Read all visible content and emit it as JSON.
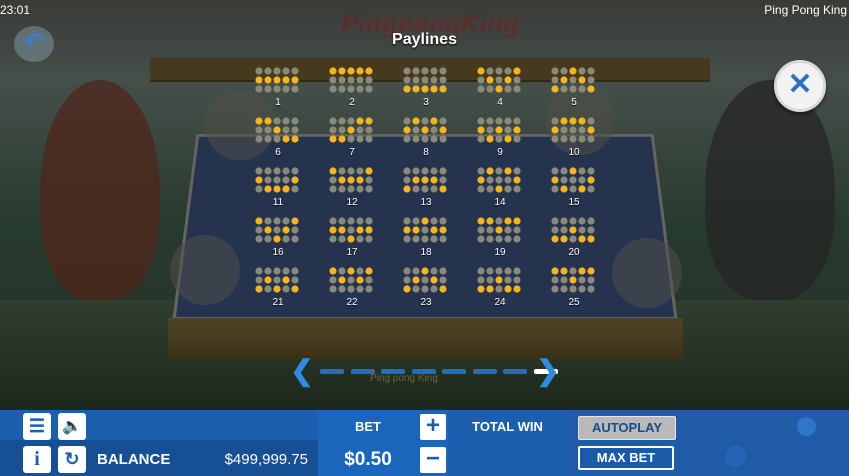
{
  "status_bar": {
    "time": "23:01",
    "app_title": "Ping Pong King"
  },
  "game": {
    "logo": "PingpongKing"
  },
  "paylines_panel": {
    "title": "Paylines",
    "lines": [
      {
        "num": "1",
        "pattern": [
          [
            0,
            0,
            0,
            0,
            0
          ],
          [
            1,
            1,
            1,
            1,
            1
          ],
          [
            0,
            0,
            0,
            0,
            0
          ]
        ]
      },
      {
        "num": "2",
        "pattern": [
          [
            1,
            1,
            1,
            1,
            1
          ],
          [
            0,
            0,
            0,
            0,
            0
          ],
          [
            0,
            0,
            0,
            0,
            0
          ]
        ]
      },
      {
        "num": "3",
        "pattern": [
          [
            0,
            0,
            0,
            0,
            0
          ],
          [
            0,
            0,
            0,
            0,
            0
          ],
          [
            1,
            1,
            1,
            1,
            1
          ]
        ]
      },
      {
        "num": "4",
        "pattern": [
          [
            1,
            0,
            0,
            0,
            1
          ],
          [
            0,
            1,
            0,
            1,
            0
          ],
          [
            0,
            0,
            1,
            0,
            0
          ]
        ]
      },
      {
        "num": "5",
        "pattern": [
          [
            0,
            0,
            1,
            0,
            0
          ],
          [
            0,
            1,
            0,
            1,
            0
          ],
          [
            1,
            0,
            0,
            0,
            1
          ]
        ]
      },
      {
        "num": "6",
        "pattern": [
          [
            1,
            1,
            0,
            0,
            0
          ],
          [
            0,
            0,
            1,
            0,
            0
          ],
          [
            0,
            0,
            0,
            1,
            1
          ]
        ]
      },
      {
        "num": "7",
        "pattern": [
          [
            0,
            0,
            0,
            1,
            1
          ],
          [
            0,
            0,
            1,
            0,
            0
          ],
          [
            1,
            1,
            0,
            0,
            0
          ]
        ]
      },
      {
        "num": "8",
        "pattern": [
          [
            0,
            1,
            0,
            1,
            0
          ],
          [
            1,
            0,
            1,
            0,
            1
          ],
          [
            0,
            0,
            0,
            0,
            0
          ]
        ]
      },
      {
        "num": "9",
        "pattern": [
          [
            0,
            0,
            0,
            0,
            0
          ],
          [
            1,
            0,
            1,
            0,
            1
          ],
          [
            0,
            1,
            0,
            1,
            0
          ]
        ]
      },
      {
        "num": "10",
        "pattern": [
          [
            0,
            1,
            1,
            1,
            0
          ],
          [
            1,
            0,
            0,
            0,
            1
          ],
          [
            0,
            0,
            0,
            0,
            0
          ]
        ]
      },
      {
        "num": "11",
        "pattern": [
          [
            0,
            0,
            0,
            0,
            0
          ],
          [
            1,
            0,
            0,
            0,
            1
          ],
          [
            0,
            1,
            1,
            1,
            0
          ]
        ]
      },
      {
        "num": "12",
        "pattern": [
          [
            1,
            0,
            0,
            0,
            1
          ],
          [
            0,
            1,
            1,
            1,
            0
          ],
          [
            0,
            0,
            0,
            0,
            0
          ]
        ]
      },
      {
        "num": "13",
        "pattern": [
          [
            0,
            0,
            0,
            0,
            0
          ],
          [
            0,
            1,
            1,
            1,
            0
          ],
          [
            1,
            0,
            0,
            0,
            1
          ]
        ]
      },
      {
        "num": "14",
        "pattern": [
          [
            0,
            1,
            0,
            1,
            0
          ],
          [
            1,
            0,
            0,
            0,
            1
          ],
          [
            0,
            0,
            1,
            0,
            0
          ]
        ]
      },
      {
        "num": "15",
        "pattern": [
          [
            0,
            0,
            1,
            0,
            0
          ],
          [
            1,
            0,
            0,
            0,
            1
          ],
          [
            0,
            1,
            0,
            1,
            0
          ]
        ]
      },
      {
        "num": "16",
        "pattern": [
          [
            1,
            0,
            0,
            0,
            1
          ],
          [
            0,
            1,
            0,
            1,
            0
          ],
          [
            0,
            0,
            1,
            0,
            0
          ]
        ]
      },
      {
        "num": "17",
        "pattern": [
          [
            0,
            0,
            0,
            0,
            0
          ],
          [
            1,
            1,
            0,
            1,
            1
          ],
          [
            0,
            0,
            1,
            0,
            0
          ]
        ]
      },
      {
        "num": "18",
        "pattern": [
          [
            0,
            0,
            1,
            0,
            0
          ],
          [
            1,
            1,
            0,
            1,
            1
          ],
          [
            0,
            0,
            0,
            0,
            0
          ]
        ]
      },
      {
        "num": "19",
        "pattern": [
          [
            1,
            1,
            0,
            1,
            1
          ],
          [
            0,
            0,
            1,
            0,
            0
          ],
          [
            0,
            0,
            0,
            0,
            0
          ]
        ]
      },
      {
        "num": "20",
        "pattern": [
          [
            0,
            0,
            0,
            0,
            0
          ],
          [
            0,
            0,
            1,
            0,
            0
          ],
          [
            1,
            1,
            0,
            1,
            1
          ]
        ]
      },
      {
        "num": "21",
        "pattern": [
          [
            0,
            0,
            0,
            0,
            0
          ],
          [
            0,
            1,
            0,
            1,
            0
          ],
          [
            1,
            0,
            1,
            0,
            1
          ]
        ]
      },
      {
        "num": "22",
        "pattern": [
          [
            1,
            0,
            1,
            0,
            1
          ],
          [
            0,
            1,
            0,
            1,
            0
          ],
          [
            0,
            0,
            0,
            0,
            0
          ]
        ]
      },
      {
        "num": "23",
        "pattern": [
          [
            0,
            0,
            1,
            0,
            0
          ],
          [
            0,
            1,
            0,
            1,
            0
          ],
          [
            1,
            0,
            0,
            0,
            1
          ]
        ]
      },
      {
        "num": "24",
        "pattern": [
          [
            0,
            0,
            0,
            0,
            0
          ],
          [
            0,
            0,
            1,
            0,
            0
          ],
          [
            1,
            1,
            0,
            1,
            1
          ]
        ]
      },
      {
        "num": "25",
        "pattern": [
          [
            1,
            1,
            0,
            1,
            1
          ],
          [
            0,
            0,
            1,
            0,
            0
          ],
          [
            0,
            0,
            0,
            0,
            0
          ]
        ]
      }
    ]
  },
  "pagination": {
    "pages": 8,
    "active_index": 7,
    "caption": "Ping pong King"
  },
  "controls": {
    "balance_label": "BALANCE",
    "balance_value": "$499,999.75",
    "bet_label": "BET",
    "bet_value": "$0.50",
    "plus": "+",
    "minus": "−",
    "total_win_label": "TOTAL WIN",
    "autoplay_label": "AUTOPLAY",
    "max_bet_label": "MAX BET"
  },
  "colors": {
    "on_dot": "#f7b41c",
    "off_dot": "#8a8a7a",
    "accent_blue": "#1b5fae"
  }
}
